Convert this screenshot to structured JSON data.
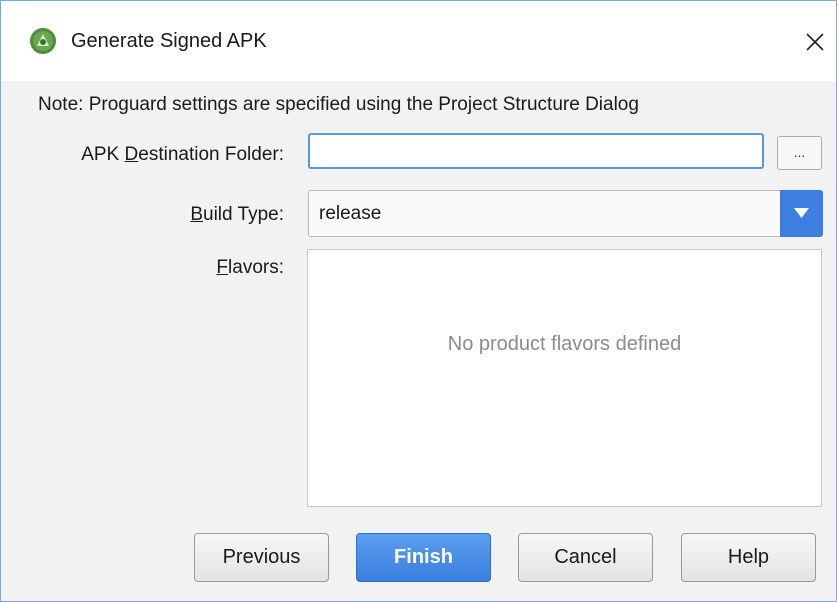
{
  "window": {
    "title": "Generate Signed APK",
    "icon": "android-studio-icon",
    "close_icon": "close-icon"
  },
  "note": "Note: Proguard settings are specified using the Project Structure Dialog",
  "destination": {
    "label_pre": "APK ",
    "label_mnemonic": "D",
    "label_post": "estination Folder:",
    "value": "",
    "browse_label": "..."
  },
  "build_type": {
    "label_mnemonic": "B",
    "label_post": "uild Type:",
    "selected": "release"
  },
  "flavors": {
    "label_mnemonic": "F",
    "label_post": "lavors:",
    "empty_text": "No product flavors defined"
  },
  "buttons": {
    "previous": "Previous",
    "finish": "Finish",
    "cancel": "Cancel",
    "help": "Help"
  },
  "colors": {
    "accent": "#3c7fe0",
    "focus_border": "#5c95da"
  }
}
